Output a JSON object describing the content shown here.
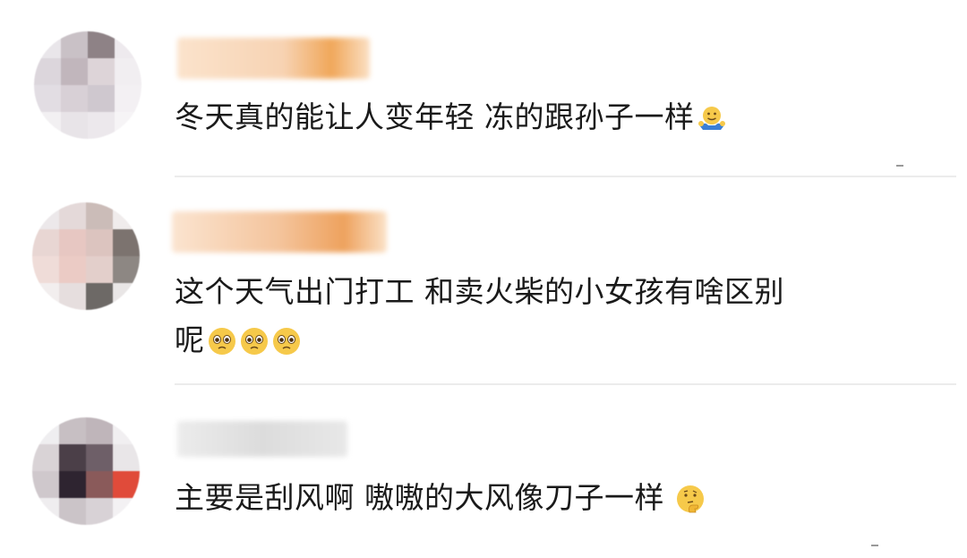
{
  "comments": [
    {
      "text": "冬天真的能让人变年轻 冻的跟孙子一样",
      "emojis": [
        "shrug-emoji"
      ]
    },
    {
      "text_line1": "这个天气出门打工 和卖火柴的小女孩有啥区别",
      "text_line2": "呢",
      "emojis": [
        "pleading-emoji",
        "pleading-emoji",
        "pleading-emoji"
      ]
    },
    {
      "text": "主要是刮风啊 嗷嗷的大风像刀子一样",
      "emojis": [
        "thinking-emoji"
      ]
    }
  ],
  "colors": {
    "text": "#1a1a1a",
    "divider": "#ececec",
    "emoji_yellow": "#f6c94a",
    "name_blur": "#f3c9a0"
  }
}
